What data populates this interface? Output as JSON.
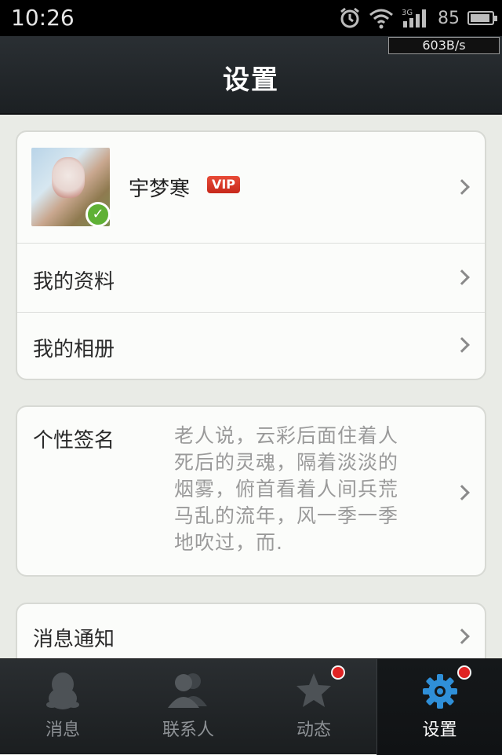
{
  "status_bar": {
    "time": "10:26",
    "battery_level": "85",
    "icons": [
      "alarm-icon",
      "wifi-icon",
      "3g-signal-icon",
      "battery-icon"
    ]
  },
  "header": {
    "title": "设置",
    "network_speed": "603B/s"
  },
  "profile": {
    "name": "宇梦寒",
    "badge": "VIP"
  },
  "menu": {
    "my_profile": "我的资料",
    "my_album": "我的相册"
  },
  "signature": {
    "label": "个性签名",
    "text": "老人说，云彩后面住着人死后的灵魂，隔着淡淡的烟雾，俯首看着人间兵荒马乱的流年，风一季一季地吹过，而."
  },
  "notifications": {
    "label": "消息通知"
  },
  "tabs": {
    "items": [
      {
        "label": "消息",
        "icon": "penguin-icon",
        "active": false,
        "badge": false
      },
      {
        "label": "联系人",
        "icon": "contacts-icon",
        "active": false,
        "badge": false
      },
      {
        "label": "动态",
        "icon": "star-icon",
        "active": false,
        "badge": true
      },
      {
        "label": "设置",
        "icon": "gear-icon",
        "active": true,
        "badge": true
      }
    ]
  },
  "colors": {
    "accent_blue": "#2f8fd8",
    "badge_red": "#e02323",
    "vip_red": "#d0301f",
    "check_green": "#5fb135"
  }
}
